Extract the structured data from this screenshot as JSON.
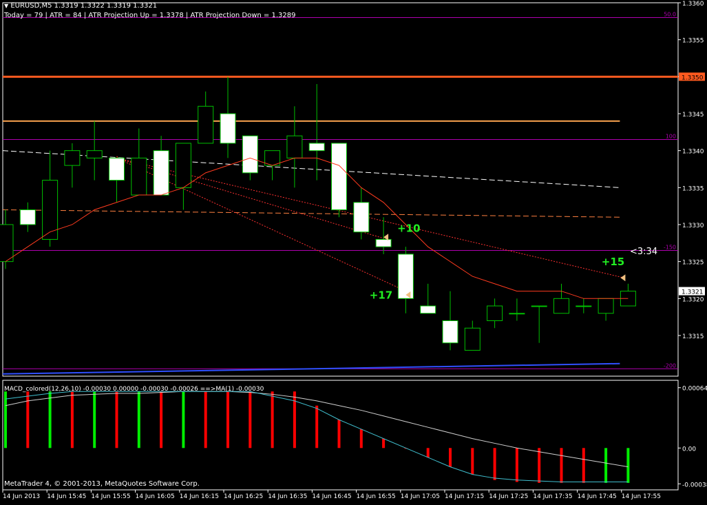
{
  "header": {
    "symbol_line": "EURUSD,M5  1.3319 1.3322 1.3319 1.3321",
    "info_line": "Today = 79   |   ATR = 84   |   ATR Projection Up = 1.3378   |   ATR Projection Down = 1.3289"
  },
  "colors": {
    "background": "#000000",
    "bull_body": "#000000",
    "bear_body": "#ffffff",
    "candle_outline": "#00c000",
    "level_line": "#b000b0",
    "resistance_line": "#ff5a1f",
    "support_line": "#ffa550",
    "ma_line": "#ff3b1f",
    "white_dash": "#ffffff",
    "orange_dash": "#ff8040",
    "projection_dots": "#ff3030",
    "annotation_green": "#22ee22",
    "macd_up": "#00ee00",
    "macd_down": "#ff0000",
    "macd_line": "#d0d0d0",
    "signal_line": "#40c0d0",
    "blue_line": "#3050ff",
    "current_price_box": "#ffffff"
  },
  "price_axis": {
    "ticks": [
      "1.3360",
      "1.3355",
      "1.3350",
      "1.3345",
      "1.3340",
      "1.3335",
      "1.3330",
      "1.3325",
      "1.3320",
      "1.3315"
    ],
    "current_price": "1.3321",
    "highlight_price": "1.3350"
  },
  "levels": [
    {
      "label": "50.0",
      "price": 1.3358
    },
    {
      "label": "100",
      "price": 1.33415
    },
    {
      "label": "-150",
      "price": 1.33265
    },
    {
      "label": "-200",
      "price": 1.33105
    }
  ],
  "annotations": [
    {
      "text": "+10",
      "price": 1.33283,
      "bar": 17
    },
    {
      "text": "+17",
      "price": 1.33205,
      "bar": 17
    },
    {
      "text": "+15",
      "price": 1.33238,
      "bar": 26
    }
  ],
  "countdown": "<3:34",
  "macd": {
    "label": "MACD_colored(12,26,10) -0.00030 0.00000 -0.00030 -0.00026  ==>MA(1) -0.00030",
    "ticks": [
      "0.00064",
      "0.00",
      "-0.00038"
    ],
    "hist": [
      0.0006,
      0.0006,
      0.0006,
      0.0006,
      0.0006,
      0.0006,
      0.0006,
      0.0006,
      0.0006,
      0.0006,
      0.0006,
      0.0006,
      0.0006,
      0.0006,
      0.00045,
      0.0003,
      0.0002,
      0.0001,
      0.0,
      -0.0001,
      -0.0002,
      -0.00028,
      -0.00034,
      -0.00036,
      -0.00037,
      -0.00037,
      -0.00037,
      -0.00037,
      -0.00037
    ],
    "hist_up": [
      true,
      false,
      true,
      false,
      true,
      false,
      true,
      false,
      true,
      false,
      false,
      false,
      false,
      false,
      false,
      false,
      false,
      false,
      false,
      false,
      false,
      false,
      false,
      false,
      false,
      false,
      false,
      true,
      true
    ],
    "macd_line": [
      0.00045,
      0.0005,
      0.00053,
      0.00056,
      0.00057,
      0.00058,
      0.00058,
      0.00059,
      0.0006,
      0.0006,
      0.0006,
      0.00059,
      0.00057,
      0.00054,
      0.0005,
      0.00045,
      0.0004,
      0.00034,
      0.00028,
      0.00022,
      0.00016,
      0.0001,
      5e-05,
      0.0,
      -4e-05,
      -8e-05,
      -0.00012,
      -0.00016,
      -0.0002
    ],
    "signal_line": [
      0.00052,
      0.00055,
      0.00058,
      0.0006,
      0.0006,
      0.0006,
      0.0006,
      0.0006,
      0.0006,
      0.0006,
      0.0006,
      0.0006,
      0.00055,
      0.0005,
      0.00042,
      0.0003,
      0.0002,
      0.0001,
      0.0,
      -0.0001,
      -0.0002,
      -0.00028,
      -0.00032,
      -0.00034,
      -0.00035,
      -0.00036,
      -0.00036,
      -0.00036,
      -0.00036
    ]
  },
  "time_axis": [
    "14 Jun 2013",
    "14 Jun 15:45",
    "14 Jun 15:55",
    "14 Jun 16:05",
    "14 Jun 16:15",
    "14 Jun 16:25",
    "14 Jun 16:35",
    "14 Jun 16:45",
    "14 Jun 16:55",
    "14 Jun 17:05",
    "14 Jun 17:15",
    "14 Jun 17:25",
    "14 Jun 17:35",
    "14 Jun 17:45",
    "14 Jun 17:55"
  ],
  "copyright": "MetaTrader 4, © 2001-2013, MetaQuotes Software Corp.",
  "chart_data": {
    "type": "candlestick",
    "symbol": "EURUSD",
    "timeframe": "M5",
    "ylim": [
      1.33095,
      1.336
    ],
    "candles": [
      {
        "o": 1.3325,
        "h": 1.3332,
        "l": 1.3324,
        "c": 1.333
      },
      {
        "o": 1.3332,
        "h": 1.3333,
        "l": 1.3329,
        "c": 1.333
      },
      {
        "o": 1.3328,
        "h": 1.334,
        "l": 1.3327,
        "c": 1.3336
      },
      {
        "o": 1.3338,
        "h": 1.3341,
        "l": 1.3335,
        "c": 1.334
      },
      {
        "o": 1.3339,
        "h": 1.3344,
        "l": 1.3336,
        "c": 1.334
      },
      {
        "o": 1.3339,
        "h": 1.3339,
        "l": 1.3333,
        "c": 1.3336
      },
      {
        "o": 1.3334,
        "h": 1.3343,
        "l": 1.3334,
        "c": 1.3339
      },
      {
        "o": 1.334,
        "h": 1.3342,
        "l": 1.3334,
        "c": 1.3334
      },
      {
        "o": 1.3335,
        "h": 1.3341,
        "l": 1.3332,
        "c": 1.3341
      },
      {
        "o": 1.3341,
        "h": 1.3348,
        "l": 1.3341,
        "c": 1.3346
      },
      {
        "o": 1.3345,
        "h": 1.335,
        "l": 1.3339,
        "c": 1.3341
      },
      {
        "o": 1.3342,
        "h": 1.3342,
        "l": 1.3336,
        "c": 1.3337
      },
      {
        "o": 1.3338,
        "h": 1.334,
        "l": 1.3336,
        "c": 1.334
      },
      {
        "o": 1.3339,
        "h": 1.3346,
        "l": 1.3335,
        "c": 1.3342
      },
      {
        "o": 1.3341,
        "h": 1.3349,
        "l": 1.3336,
        "c": 1.334
      },
      {
        "o": 1.3341,
        "h": 1.3341,
        "l": 1.3331,
        "c": 1.3332
      },
      {
        "o": 1.3333,
        "h": 1.3335,
        "l": 1.3328,
        "c": 1.3329
      },
      {
        "o": 1.3328,
        "h": 1.3331,
        "l": 1.3326,
        "c": 1.3327
      },
      {
        "o": 1.3326,
        "h": 1.3327,
        "l": 1.3318,
        "c": 1.332
      },
      {
        "o": 1.3319,
        "h": 1.3322,
        "l": 1.3318,
        "c": 1.3318
      },
      {
        "o": 1.3317,
        "h": 1.3321,
        "l": 1.3313,
        "c": 1.3314
      },
      {
        "o": 1.3313,
        "h": 1.3317,
        "l": 1.3313,
        "c": 1.3316
      },
      {
        "o": 1.3317,
        "h": 1.332,
        "l": 1.3316,
        "c": 1.3319
      },
      {
        "o": 1.3318,
        "h": 1.332,
        "l": 1.3317,
        "c": 1.3318
      },
      {
        "o": 1.3319,
        "h": 1.3319,
        "l": 1.3314,
        "c": 1.3319
      },
      {
        "o": 1.3318,
        "h": 1.3322,
        "l": 1.3318,
        "c": 1.332
      },
      {
        "o": 1.3319,
        "h": 1.332,
        "l": 1.3318,
        "c": 1.3319
      },
      {
        "o": 1.3318,
        "h": 1.332,
        "l": 1.3317,
        "c": 1.332
      },
      {
        "o": 1.3319,
        "h": 1.3322,
        "l": 1.3319,
        "c": 1.3321
      }
    ],
    "ma": [
      1.3325,
      1.3327,
      1.3329,
      1.333,
      1.3332,
      1.3333,
      1.3334,
      1.3334,
      1.3335,
      1.3337,
      1.3338,
      1.3339,
      1.3338,
      1.3339,
      1.3339,
      1.3338,
      1.3335,
      1.3333,
      1.333,
      1.3327,
      1.3325,
      1.3323,
      1.3322,
      1.3321,
      1.3321,
      1.3321,
      1.332,
      1.332,
      1.332
    ],
    "resistance": 1.335,
    "support": 1.3344,
    "white_dash": [
      1.334,
      1.3335
    ],
    "orange_dash": [
      1.3332,
      1.3331
    ]
  }
}
